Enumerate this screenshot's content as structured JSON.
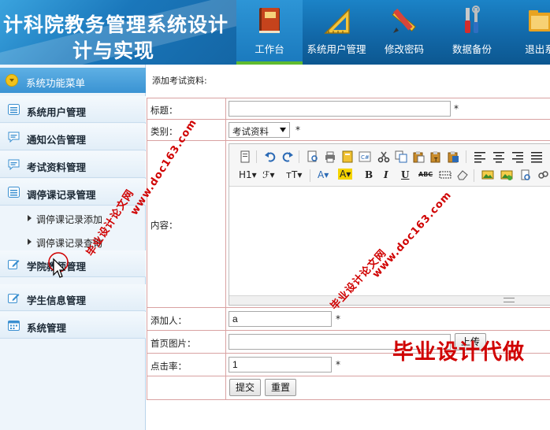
{
  "header": {
    "brand_line1": "计科院教务管理系统设计",
    "brand_line2": "计与实现",
    "nav": [
      {
        "label": "工作台",
        "icon": "book-icon",
        "active": true
      },
      {
        "label": "系统用户管理",
        "icon": "ruler-triangle-icon",
        "active": false
      },
      {
        "label": "修改密码",
        "icon": "pencil-ruler-icon",
        "active": false
      },
      {
        "label": "数据备份",
        "icon": "tools-icon",
        "active": false
      },
      {
        "label": "退出系",
        "icon": "exit-folder-icon",
        "active": false
      }
    ]
  },
  "sidebar": {
    "title": "系统功能菜单",
    "menus": [
      {
        "label": "系统用户管理",
        "icon": "list-icon"
      },
      {
        "label": "通知公告管理",
        "icon": "chat-icon"
      },
      {
        "label": "考试资料管理",
        "icon": "chat-icon"
      },
      {
        "label": "调停课记录管理",
        "icon": "list-icon"
      },
      {
        "label": "学院教师管理",
        "icon": "edit-icon"
      },
      {
        "label": "学生信息管理",
        "icon": "edit-icon"
      },
      {
        "label": "系统管理",
        "icon": "calendar-icon"
      }
    ],
    "submenus": [
      {
        "label": "调停课记录添加"
      },
      {
        "label": "调停课记录查询"
      }
    ]
  },
  "main": {
    "breadcrumb": "添加考试资料:",
    "labels": {
      "title": "标题：",
      "category": "类别：",
      "content": "内容：",
      "adder": "添加人：",
      "cover": "首页图片：",
      "clicks": "点击率："
    },
    "required_mark": "*",
    "fields": {
      "title_value": "",
      "category_value": "考试资料",
      "adder_value": "a",
      "cover_value": "",
      "clicks_value": "1"
    },
    "buttons": {
      "upload": "上传",
      "submit": "提交",
      "reset": "重置"
    },
    "editor_toolbar": {
      "heading": "H1",
      "font_family": "ℱ",
      "font_size": "тT",
      "font_color": "A",
      "highlight": "A",
      "bold": "B",
      "italic": "I",
      "underline": "U",
      "strike": "ABC"
    }
  },
  "watermarks": {
    "site": "毕业设计论文网",
    "url": "www.doc163.com",
    "ad": "毕业设计代做"
  }
}
